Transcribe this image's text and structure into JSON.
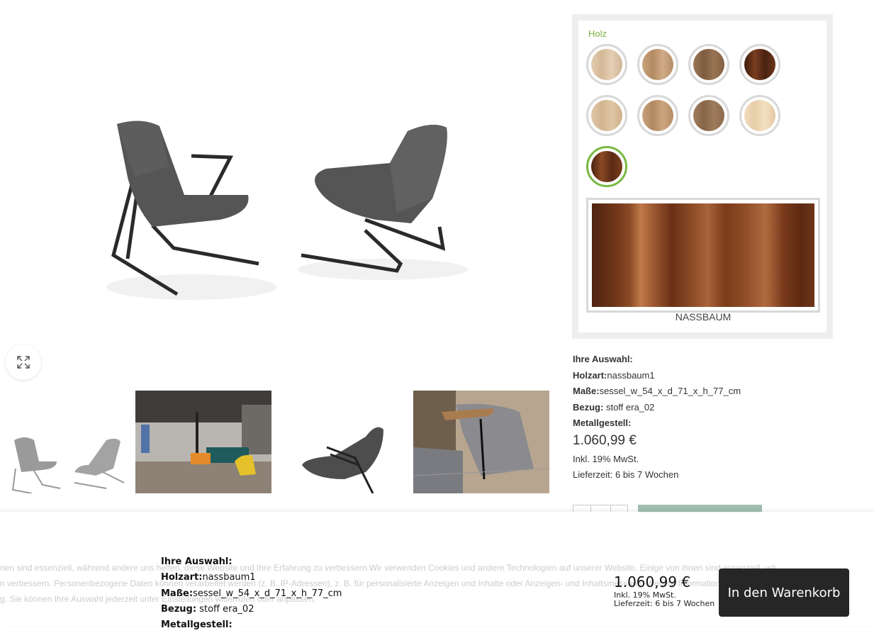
{
  "option_panel": {
    "group_label": "Holz",
    "swatches": [
      {
        "name": "ahorn",
        "color": "#dcc3a6"
      },
      {
        "name": "esche",
        "color": "#c29b75"
      },
      {
        "name": "eiche-dunkel",
        "color": "#8f6a4a"
      },
      {
        "name": "nussbaum-dunkel",
        "color": "#5a2d18"
      },
      {
        "name": "eiche-hell",
        "color": "#dbbf9e"
      },
      {
        "name": "eiche-natur",
        "color": "#c39b74"
      },
      {
        "name": "eiche-geraeuchert",
        "color": "#957255"
      },
      {
        "name": "birke",
        "color": "#ecd6b4"
      },
      {
        "name": "nassbaum",
        "color": "#5b2c16",
        "selected": true
      }
    ],
    "preview_label": "NASSBAUM"
  },
  "selection": {
    "heading": "Ihre Auswahl:",
    "holzart_label": "Holzart:",
    "holzart_value": "nassbaum1",
    "masse_label": "Maße:",
    "masse_value": "sessel_w_54_x_d_71_x_h_77_cm",
    "bezug_label": "Bezug:",
    "bezug_value": " stoff era_02",
    "metall_label": "Metallgestell:"
  },
  "pricing": {
    "price": "1.060,99 €",
    "tax": "Inkl. 19% MwSt.",
    "delivery": "Lieferzeit: 6 bis 7 Wochen"
  },
  "cookie_text": {
    "line1": "nen sind essenziell, während andere uns helfen, diese Website und Ihre Erfahrung zu verbessern.Wir verwenden Cookies und andere Technologien auf unserer Website. Einige von ihnen sind essenziell, wä",
    "line2": "n verbessern. Personenbezogene Daten können verarbeitet werden (z. B. IP-Adressen), z. B. für personalisierte Anzeigen und Inhalte oder Anzeigen- und Inhaltsmessung. Weitere Informationen über die Ve",
    "line3": "g. Sie können Ihre Auswahl jederzeit unter Einstellungen widerrufen oder anpassen."
  },
  "sticky_bar": {
    "cart_button": "In den Warenkorb"
  }
}
